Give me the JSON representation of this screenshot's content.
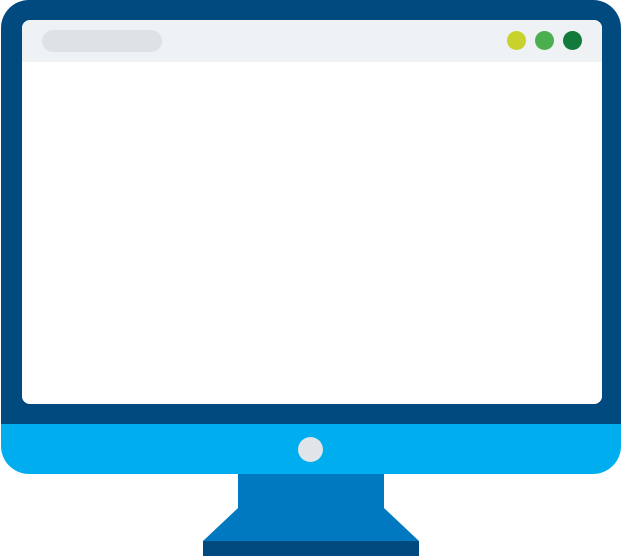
{
  "colors": {
    "bezel": "#004a80",
    "chin": "#00aeef",
    "screen": "#ffffff",
    "browser_bar": "#eef2f5",
    "address_pill": "#dde2e6",
    "dot_yellow": "#c8d22a",
    "dot_green": "#4caf4f",
    "dot_dark_green": "#137a3b",
    "power_button": "#e1e4e8",
    "stand_neck": "#0079c1",
    "stand_base_top": "#0079c1",
    "stand_base_bottom": "#004a80"
  },
  "icons": {
    "monitor": "desktop-monitor-icon",
    "window_controls": "window-control-dots",
    "power": "power-button"
  }
}
